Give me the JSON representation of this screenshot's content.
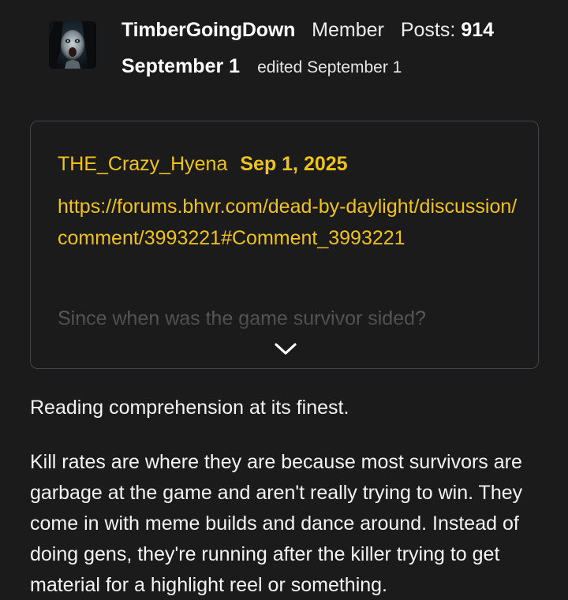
{
  "author": {
    "username": "TimberGoingDown",
    "role": "Member",
    "posts_label": "Posts:",
    "posts_count": "914",
    "avatar_icon": "horror-face-avatar"
  },
  "post": {
    "date": "September 1",
    "edited": "edited September 1"
  },
  "quote": {
    "author": "THE_Crazy_Hyena",
    "date": "Sep 1, 2025",
    "link": "https://forums.bhvr.com/dead-by-daylight/discussion/comment/3993221#Comment_3993221",
    "text": "Since when was the game survivor sided?",
    "expand_icon": "chevron-down-icon"
  },
  "body": {
    "paragraph1": "Reading comprehension at its finest.",
    "paragraph2": "Kill rates are where they are because most survivors are garbage at the game and aren't really trying to win. They come in with meme builds and dance around. Instead of doing gens, they're running after the killer trying to get material for a highlight reel or something."
  },
  "colors": {
    "background": "#1b1b1c",
    "accent": "#f0c21c",
    "text": "#f4f4f4",
    "border": "#46464a"
  }
}
